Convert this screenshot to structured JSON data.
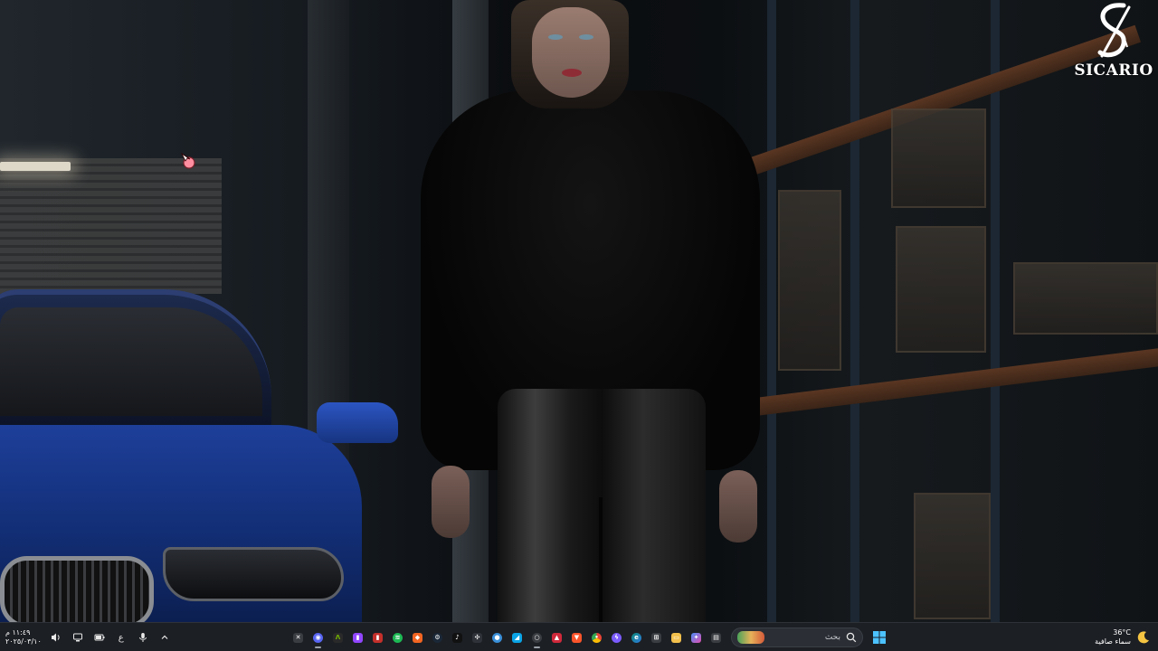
{
  "desktop": {
    "logo": {
      "text": "SICARIO"
    }
  },
  "taskbar": {
    "clock": {
      "time": "١١:٤٩ م",
      "date": "٢٠٢٥/٠٣/١٠"
    },
    "tray": {
      "language": "ع",
      "icons": [
        "speaker-icon",
        "network-icon",
        "battery-icon",
        "language-indicator",
        "microphone-icon",
        "chevron-up-icon"
      ]
    },
    "apps": [
      {
        "name": "xbox-icon",
        "color": "#3a3d42"
      },
      {
        "name": "discord-icon",
        "color": "#5865f2"
      },
      {
        "name": "nvidia-icon",
        "color": "#2a2a2a"
      },
      {
        "name": "twitch-icon",
        "color": "#9146ff"
      },
      {
        "name": "app-red-icon",
        "color": "#c4302b"
      },
      {
        "name": "spotify-icon",
        "color": "#1db954"
      },
      {
        "name": "app-orange-icon",
        "color": "#f26522"
      },
      {
        "name": "steam-icon",
        "color": "#1b2838"
      },
      {
        "name": "tiktok-icon",
        "color": "#111111"
      },
      {
        "name": "game-controller-icon",
        "color": "#2f3238"
      },
      {
        "name": "app-blue-icon",
        "color": "#3a8fd8"
      },
      {
        "name": "app-cyan-icon",
        "color": "#0aa4e6"
      },
      {
        "name": "settings-app-icon",
        "color": "#3a3d42"
      },
      {
        "name": "app-rose-icon",
        "color": "#d0293b"
      },
      {
        "name": "brave-icon",
        "color": "#fb542b"
      },
      {
        "name": "chrome-icon",
        "color": "#34a853"
      },
      {
        "name": "messenger-icon",
        "color": "#7b5cff"
      },
      {
        "name": "edge-icon",
        "color": "#0c8a78"
      },
      {
        "name": "store-icon",
        "color": "#3a3d42"
      },
      {
        "name": "file-explorer-icon",
        "color": "#f2c04d"
      },
      {
        "name": "copilot-icon",
        "color": "#4a8df8"
      },
      {
        "name": "task-view-icon",
        "color": "#3a3d42"
      }
    ],
    "search": {
      "placeholder": "بحث"
    },
    "weather": {
      "temperature": "36°C",
      "condition": "سماء صافية"
    },
    "colors": {
      "background": "#1c1f24",
      "accent": "#0078d4"
    }
  }
}
